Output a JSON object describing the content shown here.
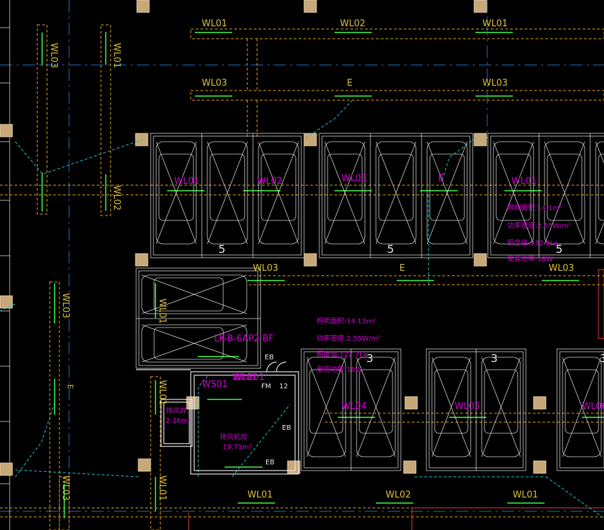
{
  "colors": {
    "background": "#000000",
    "circuit": "#e8a317",
    "circuit_label": "#d9c23a",
    "fixture_bar": "#2fbf3a",
    "parking": "#d8d8d8",
    "column": "#c8a878",
    "axis": "#1a74d6",
    "dashed_cyan": "#1fc9d9",
    "magenta_text": "#d400d4",
    "room_wall": "#e8e8e8"
  },
  "circuit_labels": {
    "top_wl01_a": "WL01",
    "top_wl02": "WL02",
    "top_wl01_b": "WL01",
    "row2_wl03_a": "WL03",
    "row2_e": "E",
    "row2_wl03_b": "WL03",
    "v_wl03_left": "WL03",
    "v_wl01_left": "WL01",
    "v_wl02_left": "WL02",
    "v_wl03_mid": "WL03",
    "lot_wl01_a": "WL01",
    "lot_wl02_a": "WL02",
    "lot_wl03_a": "WL03",
    "lot_wl01_b": "WL01",
    "mid_wl03": "WL03",
    "mid_e": "E",
    "mid_wl03_b": "WL03",
    "v_wl01_room": "WL01",
    "v_wl01_small": "WL01",
    "bot_wl04": "WL04",
    "bot_wl05": "WL05",
    "bot_wl06": "WL06",
    "bottom_wl01_a": "WL01",
    "bottom_wl02": "WL02",
    "bottom_wl01_b": "WL01",
    "v_wl03_bottom": "WL03",
    "v_wl01_bottom": "WL01",
    "v_wl01_room2": "WL01",
    "e_small": "E",
    "e_mid": "E"
  },
  "annotations": {
    "upper_area": "照明面积:14.1m²",
    "upper_density": "功率密度:2.85W/m²",
    "upper_lux": "照度值:232.8Lx",
    "upper_power": "安装功率:18W",
    "lower_area": "照明面积:14.13m²",
    "lower_density": "功率密度:2.55W/m²",
    "lower_lux": "照度值:122.7Lx",
    "lower_power": "安装功率:18W",
    "panel_id": "LK-B-6AP2-BF",
    "ws01": "WS01",
    "wle01": "WLE01",
    "fm_label": "FM",
    "fm_num": "12",
    "eb1": "EB",
    "eb2": "EB",
    "eb3": "EB",
    "room_name": "排风机房",
    "room_area": "19.71m²",
    "shaft_name": "排风井",
    "shaft_area": "2.16m²",
    "num_5a": "5",
    "num_5b": "5",
    "num_5c": "5",
    "num_3a": "3",
    "num_3b": "3",
    "num_3c": "3"
  }
}
